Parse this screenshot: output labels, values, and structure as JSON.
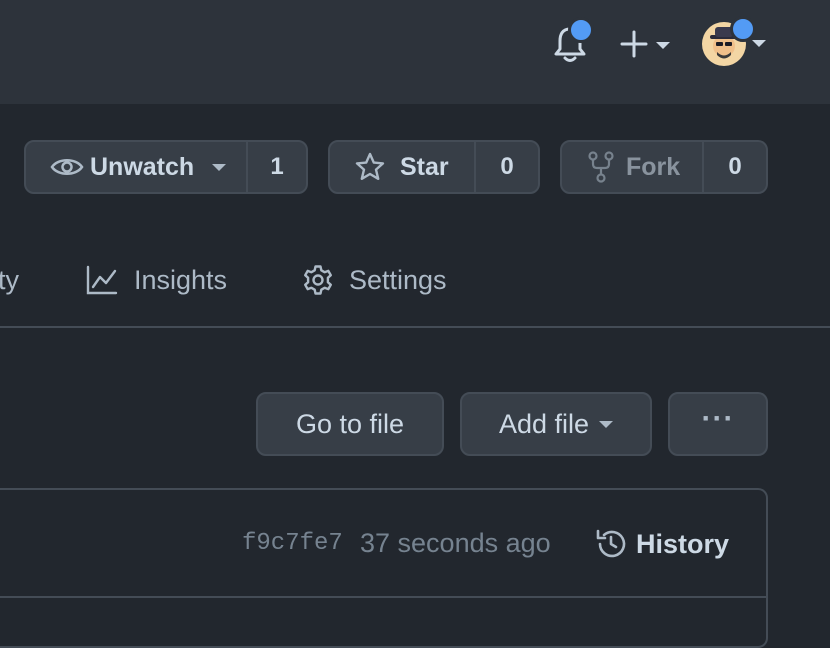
{
  "header": {
    "icons": [
      "bell-icon",
      "plus-icon",
      "caret-down-icon",
      "avatar"
    ],
    "accent_color": "#539bf5"
  },
  "repo_actions": {
    "watch": {
      "label": "Unwatch",
      "count": "1"
    },
    "star": {
      "label": "Star",
      "count": "0"
    },
    "fork": {
      "label": "Fork",
      "count": "0"
    }
  },
  "tabs": [
    {
      "label": "ty"
    },
    {
      "label": "Insights"
    },
    {
      "label": "Settings"
    }
  ],
  "file_actions": {
    "go_to_file": "Go to file",
    "add_file": "Add file",
    "more": "···"
  },
  "commit": {
    "sha": "f9c7fe7",
    "time": "37 seconds ago",
    "history_label": "History"
  }
}
